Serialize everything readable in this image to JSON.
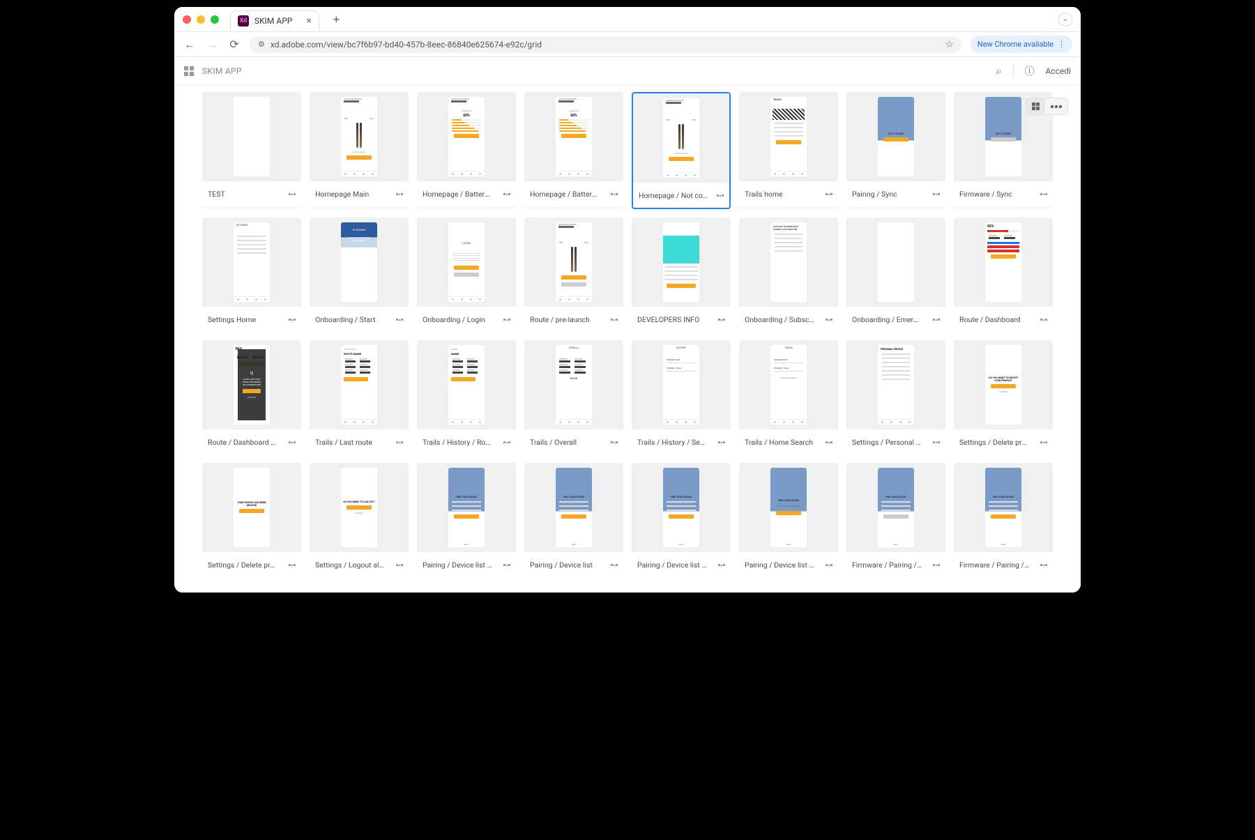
{
  "browser": {
    "tab_title": "SKIM APP",
    "tab_icon_text": "Xd",
    "url": "xd.adobe.com/view/bc7f6b97-bd40-457b-8eec-86840e625674-e92c/grid",
    "chrome_update": "New Chrome available"
  },
  "header": {
    "app_name": "SKIM APP",
    "signin": "Accedi"
  },
  "screen_text": {
    "welcome": "Welcome back",
    "name": "NAME SURNAME",
    "device": "Device name",
    "pct60": "60%",
    "pct65": "65%",
    "pct86": "86%",
    "sync": "LET'S SYNC!",
    "login": "LOGIN",
    "eskimo": "ESKIMO",
    "ready": "READY FOR YOUR NEXT ADVENTURE?",
    "dev_info": "DEVELOPERS INFO",
    "onb": "LET'S GET TO KNOW EACH OTHER A LITTLE BETTER",
    "settings": "SETTINGS",
    "find": "FIND YOUR DEVICE",
    "overall": "OVERALL",
    "history": "HISTORY",
    "trails": "TRAILS",
    "last_route": "LAST ROUTE",
    "route_name": "ROUTE NAME",
    "personal": "PERSONAL PROFILE",
    "delete_q": "DO YOU WANT TO DELETE YOUR PROFILE?",
    "deleted": "YOUR PROFILE HAS BEEN DELETED",
    "logout_q": "DO YOU WANT TO LOG OUT?",
    "looks_like": "LOOKS LIKE YOUR ROUTE RECORDING GOT INTERRUPTED",
    "trail1": "Whistler/Land",
    "trail2": "Whistler / Snow",
    "fav": "Favorite buildings",
    "dist": "1.258",
    "dist_unit": "KM",
    "alt": "41.230",
    "alt_unit": "M",
    "bpm": "90",
    "time_hm": "00:00"
  },
  "artboards": [
    {
      "label": "TEST",
      "type": "blank"
    },
    {
      "label": "Homepage Main",
      "type": "home"
    },
    {
      "label": "Homepage / Battery d…",
      "type": "battery"
    },
    {
      "label": "Homepage / Battery d…",
      "type": "battery"
    },
    {
      "label": "Homepage / Not conn…",
      "type": "home",
      "selected": true
    },
    {
      "label": "Trails home",
      "type": "trails"
    },
    {
      "label": "Pairing / Sync",
      "type": "sync"
    },
    {
      "label": "Firmware / Sync",
      "type": "sync_gray"
    },
    {
      "label": "Settings Home",
      "type": "settings"
    },
    {
      "label": "Onboarding / Start",
      "type": "eskimo"
    },
    {
      "label": "Onboarding /  Login",
      "type": "login"
    },
    {
      "label": "Route / pre-launch",
      "type": "prelaunch"
    },
    {
      "label": "DEVELOPERS INFO",
      "type": "devinfo"
    },
    {
      "label": "Onboarding / Subscrip…",
      "type": "subscription"
    },
    {
      "label": "Onboarding / Emerge…",
      "type": "blank"
    },
    {
      "label": "Route / Dashboard",
      "type": "dashboard"
    },
    {
      "label": "Route / Dashboard / P…",
      "type": "dashboard_modal"
    },
    {
      "label": "Trails / Last route",
      "type": "lastroute"
    },
    {
      "label": "Trails / History / Route…",
      "type": "routehist"
    },
    {
      "label": "Trails / Overall",
      "type": "overall"
    },
    {
      "label": "Trails / History / Search",
      "type": "histsearch"
    },
    {
      "label": "Trails / Home Search",
      "type": "homesearch"
    },
    {
      "label": "Settings / Personal pro…",
      "type": "personal"
    },
    {
      "label": "Settings / Delete profil…",
      "type": "delete_q"
    },
    {
      "label": "Settings / Delete profil…",
      "type": "deleted"
    },
    {
      "label": "Settings / Logout alert",
      "type": "logout"
    },
    {
      "label": "Pairing / Device list / S…",
      "type": "find"
    },
    {
      "label": "Pairing / Device list",
      "type": "find"
    },
    {
      "label": "Pairing / Device list / S…",
      "type": "find"
    },
    {
      "label": "Pairing / Device list / Nothin…",
      "type": "find_nothing"
    },
    {
      "label": "Firmware / Pairing /  D…",
      "type": "find_gray"
    },
    {
      "label": "Firmware / Pairing / D…",
      "type": "find"
    }
  ]
}
